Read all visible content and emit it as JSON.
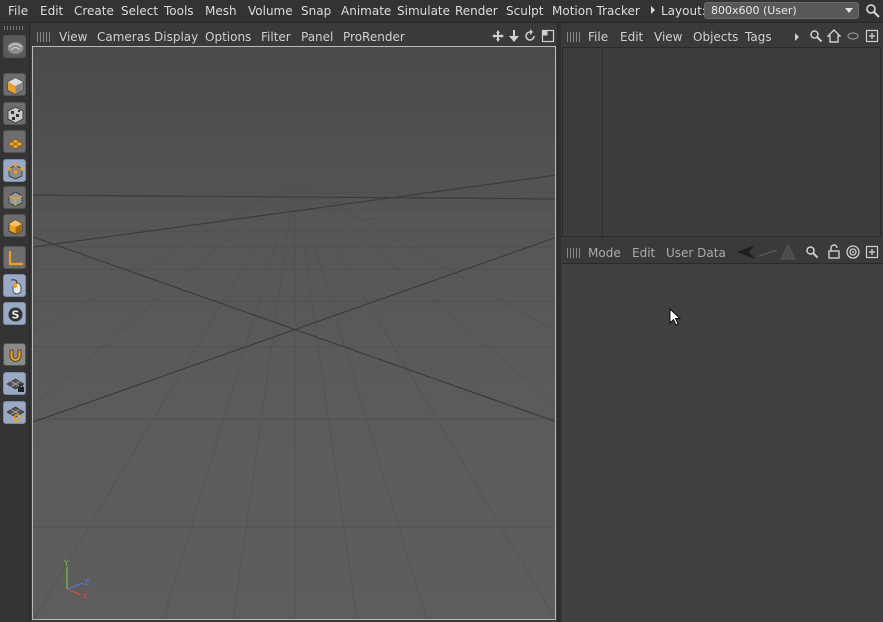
{
  "menubar": {
    "items": [
      "File",
      "Edit",
      "Create",
      "Select",
      "Tools",
      "Mesh",
      "Volume",
      "Snap",
      "Animate",
      "Simulate",
      "Render",
      "Sculpt",
      "Motion Tracker"
    ],
    "layout_label": "Layout:",
    "layout_value": "800x600 (User)"
  },
  "viewport": {
    "menu": [
      "View",
      "Cameras",
      "Display",
      "Options",
      "Filter",
      "Panel",
      "ProRender"
    ],
    "axis_labels": {
      "y": "Y",
      "z": "Z",
      "x": "X"
    }
  },
  "object_manager": {
    "menu": [
      "File",
      "Edit",
      "View",
      "Objects",
      "Tags"
    ]
  },
  "attribute_manager": {
    "menu": [
      "Mode",
      "Edit",
      "User Data"
    ]
  },
  "colors": {
    "accent_blue": "#9aa9c4",
    "orange": "#f0a020",
    "background": "#3a3a3a"
  }
}
